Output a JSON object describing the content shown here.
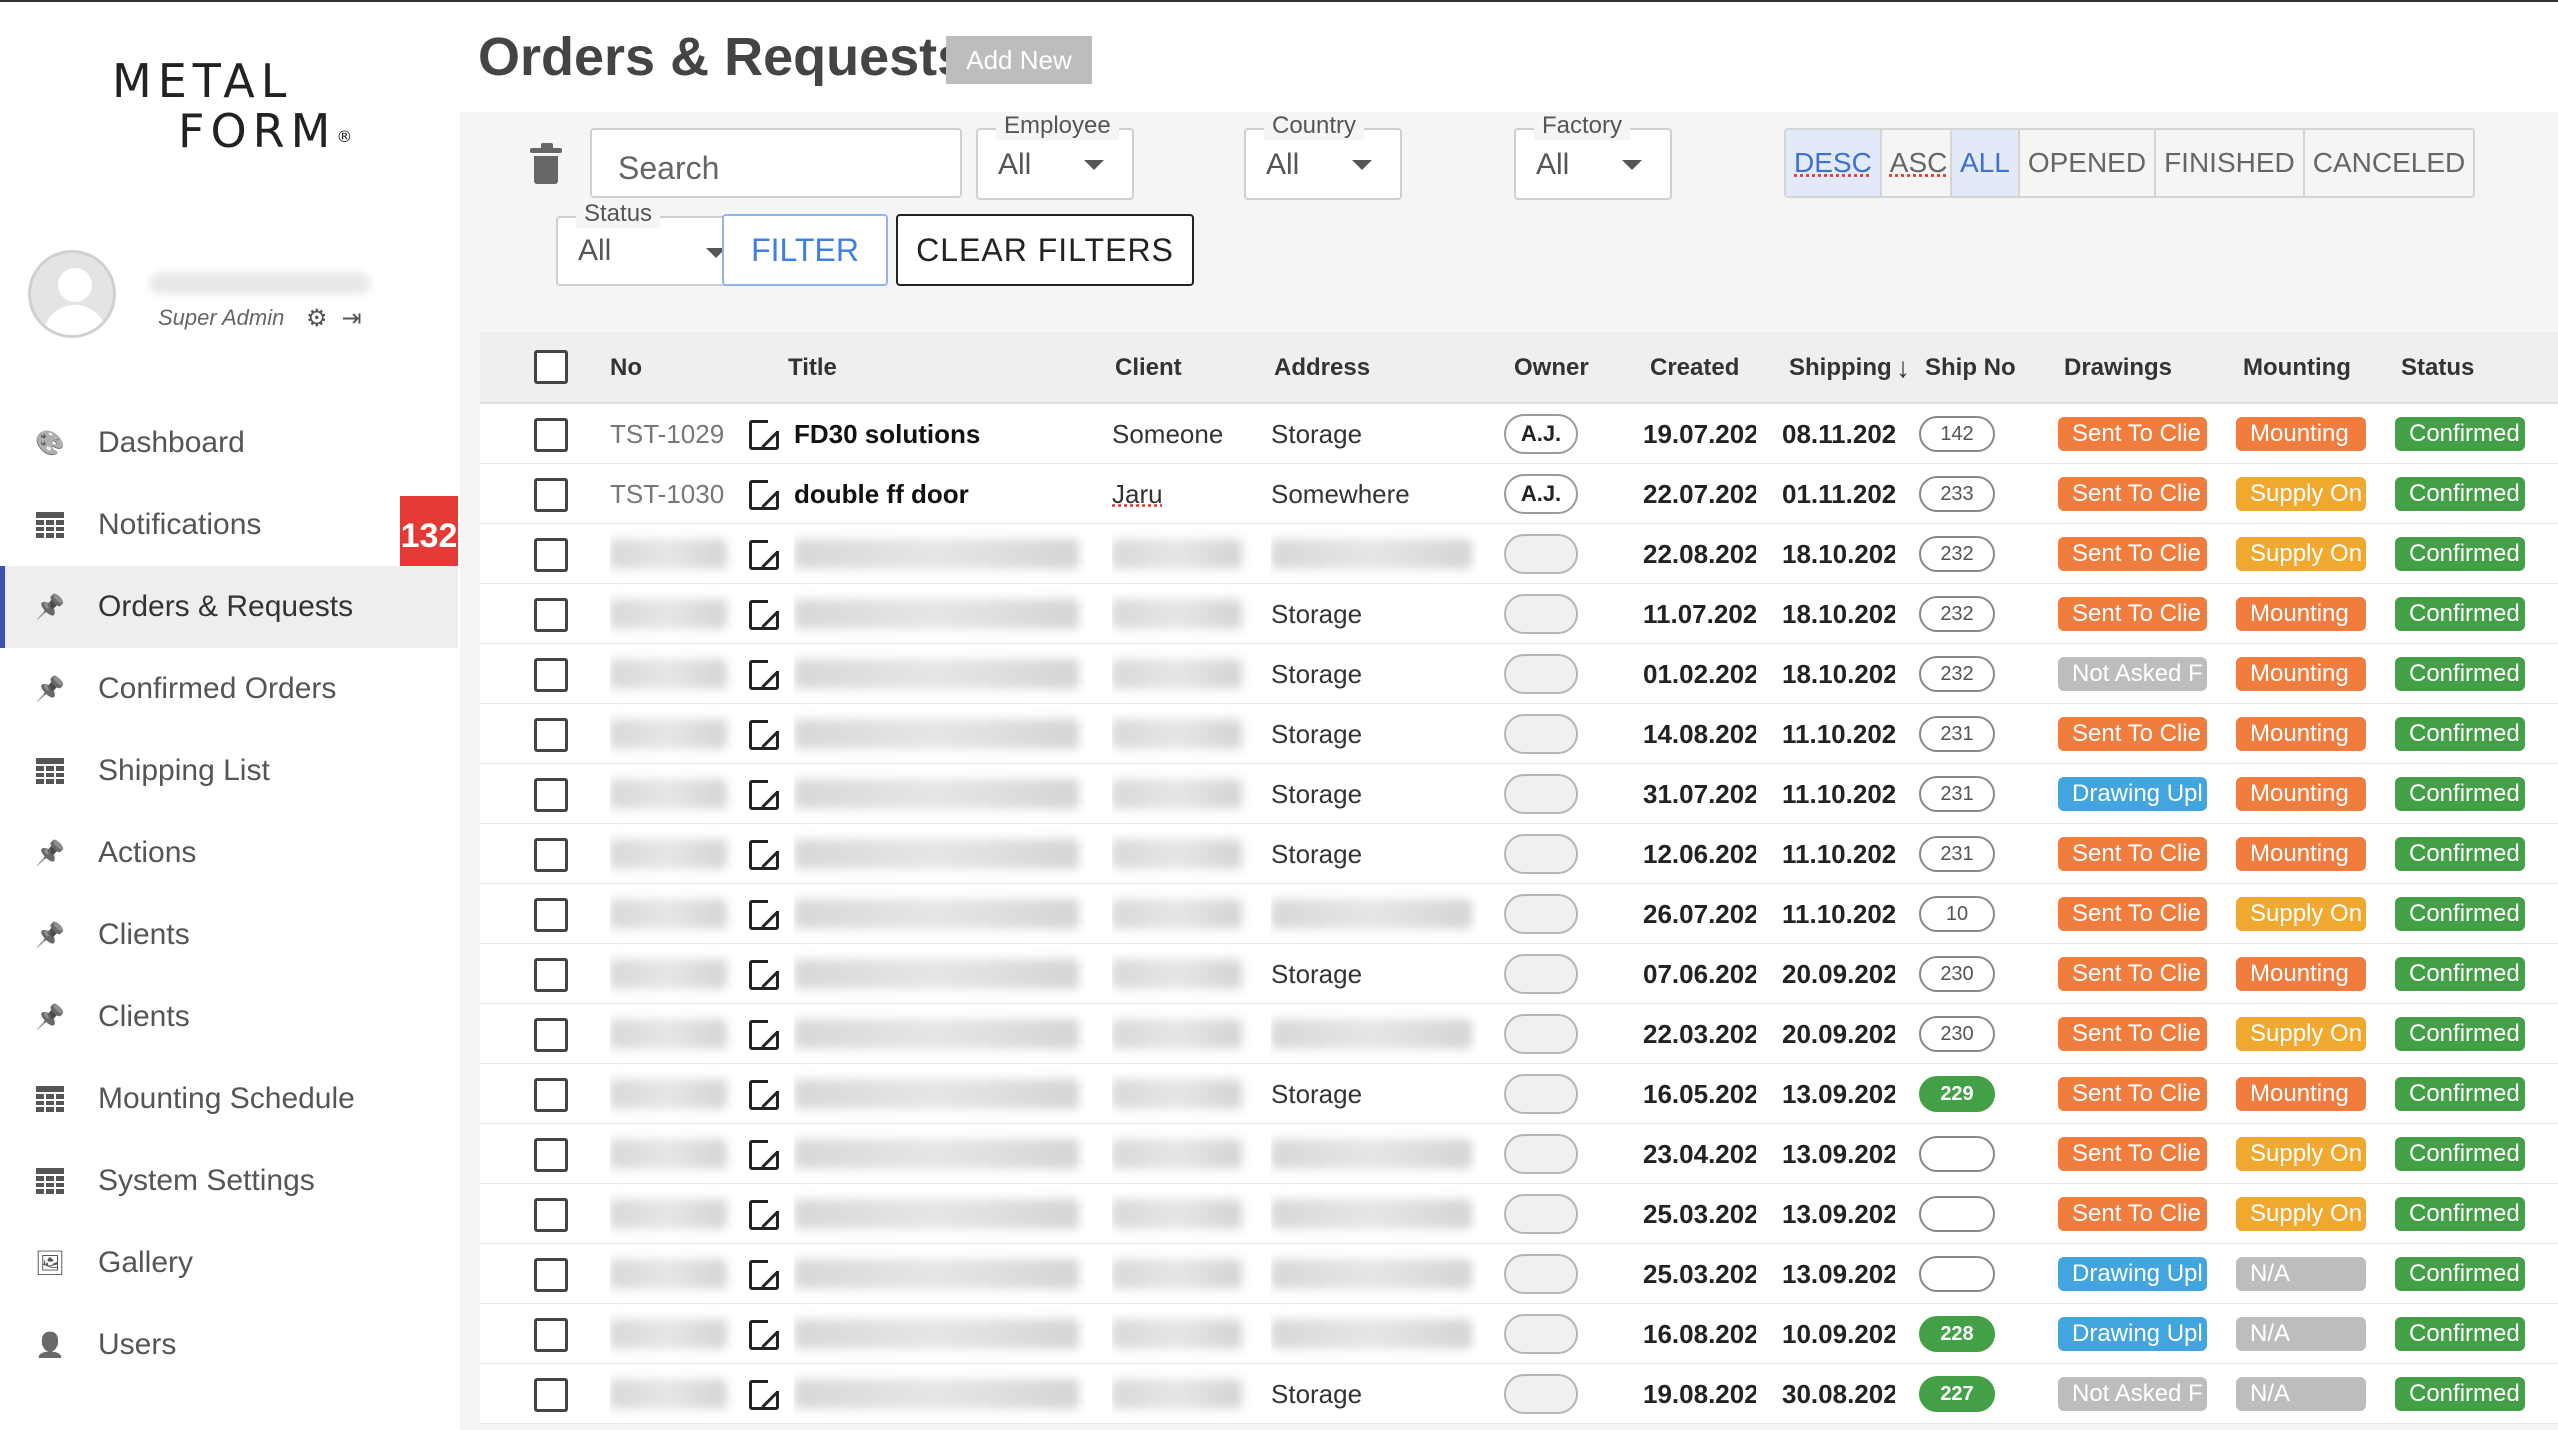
{
  "brand": {
    "line1": "METAL",
    "line2": "FORM",
    "mark": "®"
  },
  "profile": {
    "role": "Super Admin",
    "icons": [
      "gear-icon",
      "logout-icon"
    ]
  },
  "nav": [
    {
      "label": "Dashboard",
      "icon": "palette-icon"
    },
    {
      "label": "Notifications",
      "icon": "table-icon",
      "badge": "132"
    },
    {
      "label": "Orders & Requests",
      "icon": "pin-icon",
      "active": true
    },
    {
      "label": "Confirmed Orders",
      "icon": "pin-icon"
    },
    {
      "label": "Shipping List",
      "icon": "table-icon"
    },
    {
      "label": "Actions",
      "icon": "pin-icon"
    },
    {
      "label": "Clients",
      "icon": "pin-icon"
    },
    {
      "label": "Clients",
      "icon": "pin-icon"
    },
    {
      "label": "Mounting Schedule",
      "icon": "table-icon"
    },
    {
      "label": "System Settings",
      "icon": "table-icon"
    },
    {
      "label": "Gallery",
      "icon": "gallery-icon"
    },
    {
      "label": "Users",
      "icon": "user-icon"
    }
  ],
  "header": {
    "title": "Orders & Requests",
    "add_new": "Add New"
  },
  "filters": {
    "search_placeholder": "Search",
    "employee": {
      "label": "Employee",
      "value": "All"
    },
    "country": {
      "label": "Country",
      "value": "All"
    },
    "factory": {
      "label": "Factory",
      "value": "All"
    },
    "status": {
      "label": "Status",
      "value": "All"
    },
    "sort": [
      "DESC",
      "ASC"
    ],
    "state_tabs": [
      "ALL",
      "OPENED",
      "FINISHED",
      "CANCELED"
    ],
    "filter_button": "FILTER",
    "clear_button": "CLEAR FILTERS"
  },
  "table": {
    "columns": [
      "No",
      "Title",
      "Client",
      "Address",
      "Owner",
      "Created",
      "Shipping",
      "Ship No",
      "Drawings",
      "Mounting",
      "Status"
    ],
    "rows": [
      {
        "no": "TST-1029",
        "title": "FD30 solutions",
        "client": "Someone",
        "address": "Storage",
        "owner": "A.J.",
        "created": "19.07.202",
        "shipping": "08.11.202",
        "ship_no": "142",
        "drawings": "Sent To Clie",
        "mounting": "Mounting",
        "status": "Confirmed"
      },
      {
        "no": "TST-1030",
        "title": "double ff door",
        "client": "Jaru",
        "address": "Somewhere",
        "owner": "A.J.",
        "created": "22.07.202",
        "shipping": "01.11.202",
        "ship_no": "233",
        "drawings": "Sent To Clie",
        "mounting": "Supply On",
        "status": "Confirmed"
      },
      {
        "no": "",
        "title": "",
        "client": "",
        "address": "",
        "owner": "",
        "created": "22.08.202",
        "shipping": "18.10.202",
        "ship_no": "232",
        "drawings": "Sent To Clie",
        "mounting": "Supply On",
        "status": "Confirmed"
      },
      {
        "no": "",
        "title": "",
        "client": "",
        "address": "Storage",
        "owner": "",
        "created": "11.07.202",
        "shipping": "18.10.202",
        "ship_no": "232",
        "drawings": "Sent To Clie",
        "mounting": "Mounting",
        "status": "Confirmed"
      },
      {
        "no": "",
        "title": "",
        "client": "",
        "address": "Storage",
        "owner": "",
        "created": "01.02.202",
        "shipping": "18.10.202",
        "ship_no": "232",
        "drawings": "Not Asked F",
        "mounting": "Mounting",
        "status": "Confirmed"
      },
      {
        "no": "",
        "title": "",
        "client": "",
        "address": "Storage",
        "owner": "",
        "created": "14.08.202",
        "shipping": "11.10.202",
        "ship_no": "231",
        "drawings": "Sent To Clie",
        "mounting": "Mounting",
        "status": "Confirmed"
      },
      {
        "no": "",
        "title": "",
        "client": "",
        "address": "Storage",
        "owner": "",
        "created": "31.07.202",
        "shipping": "11.10.202",
        "ship_no": "231",
        "drawings": "Drawing Upl",
        "mounting": "Mounting",
        "status": "Confirmed"
      },
      {
        "no": "",
        "title": "",
        "client": "",
        "address": "Storage",
        "owner": "",
        "created": "12.06.202",
        "shipping": "11.10.202",
        "ship_no": "231",
        "drawings": "Sent To Clie",
        "mounting": "Mounting",
        "status": "Confirmed"
      },
      {
        "no": "",
        "title": "",
        "client": "",
        "address": "",
        "owner": "",
        "created": "26.07.202",
        "shipping": "11.10.202",
        "ship_no": "10",
        "drawings": "Sent To Clie",
        "mounting": "Supply On",
        "status": "Confirmed"
      },
      {
        "no": "",
        "title": "",
        "client": "",
        "address": "Storage",
        "owner": "",
        "created": "07.06.202",
        "shipping": "20.09.202",
        "ship_no": "230",
        "drawings": "Sent To Clie",
        "mounting": "Mounting",
        "status": "Confirmed"
      },
      {
        "no": "",
        "title": "",
        "client": "",
        "address": "",
        "owner": "",
        "created": "22.03.202",
        "shipping": "20.09.202",
        "ship_no": "230",
        "drawings": "Sent To Clie",
        "mounting": "Supply On",
        "status": "Confirmed"
      },
      {
        "no": "",
        "title": "",
        "client": "",
        "address": "Storage",
        "owner": "",
        "created": "16.05.202",
        "shipping": "13.09.202",
        "ship_no": "229",
        "ship_green": true,
        "drawings": "Sent To Clie",
        "mounting": "Mounting",
        "status": "Confirmed"
      },
      {
        "no": "",
        "title": "",
        "client": "",
        "address": "",
        "owner": "",
        "created": "23.04.202",
        "shipping": "13.09.202",
        "ship_no": "",
        "drawings": "Sent To Clie",
        "mounting": "Supply On",
        "status": "Confirmed"
      },
      {
        "no": "",
        "title": "",
        "client": "",
        "address": "",
        "owner": "",
        "created": "25.03.202",
        "shipping": "13.09.202",
        "ship_no": "",
        "drawings": "Sent To Clie",
        "mounting": "Supply On",
        "status": "Confirmed"
      },
      {
        "no": "",
        "title": "",
        "client": "",
        "address": "",
        "owner": "",
        "created": "25.03.202",
        "shipping": "13.09.202",
        "ship_no": "",
        "drawings": "Drawing Upl",
        "mounting": "N/A",
        "status": "Confirmed"
      },
      {
        "no": "",
        "title": "",
        "client": "",
        "address": "",
        "owner": "",
        "created": "16.08.202",
        "shipping": "10.09.202",
        "ship_no": "228",
        "ship_green": true,
        "drawings": "Drawing Upl",
        "mounting": "N/A",
        "status": "Confirmed"
      },
      {
        "no": "",
        "title": "",
        "client": "",
        "address": "Storage",
        "owner": "",
        "created": "19.08.202",
        "shipping": "30.08.202",
        "ship_no": "227",
        "ship_green": true,
        "drawings": "Not Asked F",
        "mounting": "N/A",
        "status": "Confirmed"
      }
    ]
  },
  "colors": {
    "accent": "#3f51b5",
    "orange": "#f07c3e",
    "yellow": "#f0a92e",
    "blue": "#42a5e0",
    "grey": "#bdbdbd",
    "green": "#43a047",
    "badge_red": "#e53935"
  }
}
